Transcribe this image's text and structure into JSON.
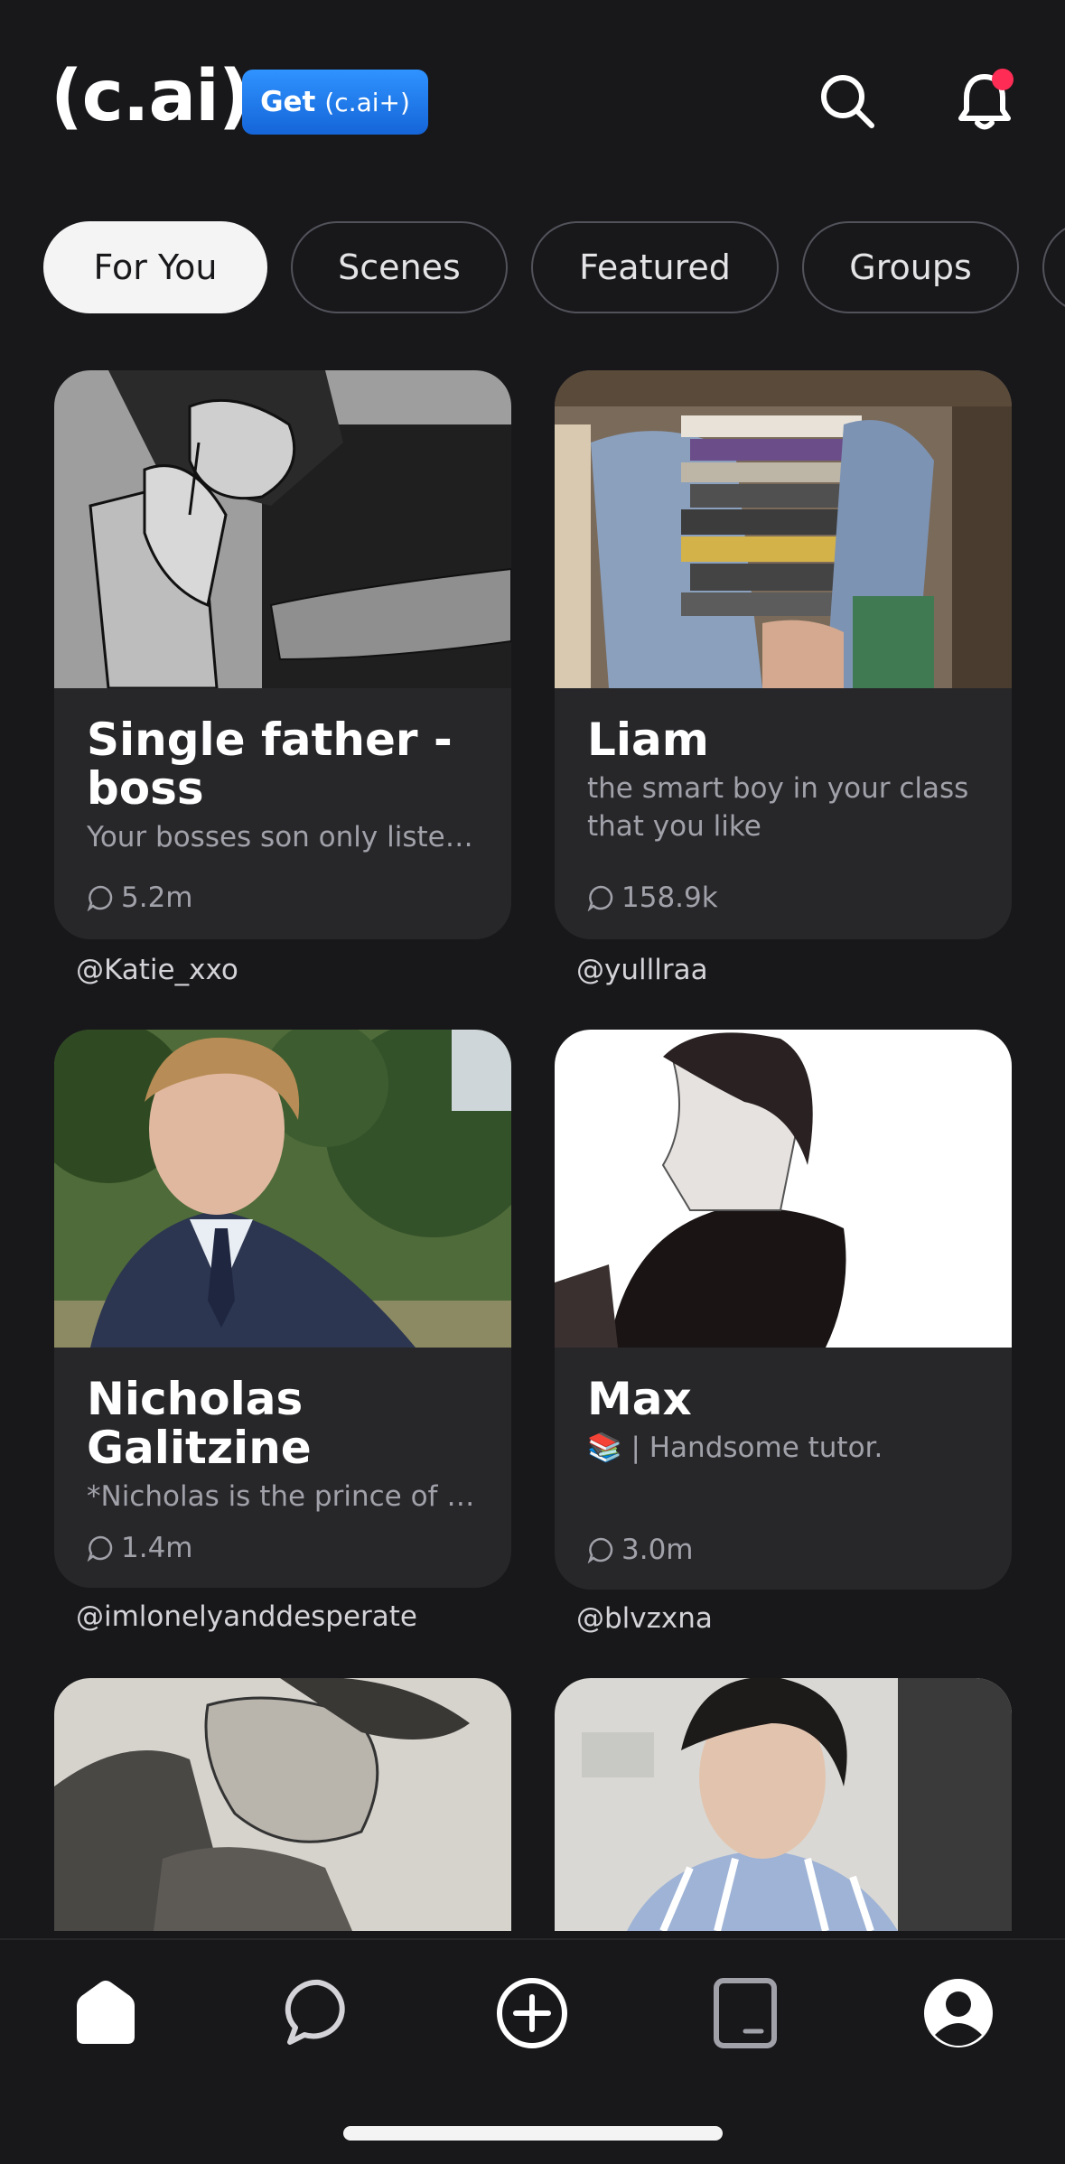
{
  "header": {
    "logo": "(c.ai)",
    "plus_get": "Get",
    "plus_tier": "(c.ai+)",
    "search_icon": "search-icon",
    "bell_icon": "bell-icon",
    "colors": {
      "accent": "#1f7ae8",
      "notify_dot": "#ff2d55"
    }
  },
  "tabs": [
    {
      "label": "For You",
      "active": true
    },
    {
      "label": "Scenes"
    },
    {
      "label": "Featured"
    },
    {
      "label": "Groups"
    }
  ],
  "cards": [
    {
      "title": "Single father - boss",
      "description": "Your bosses son only listen...",
      "chats": "5.2m",
      "creator": "@Katie_xxo"
    },
    {
      "title": "Liam",
      "description": "the smart boy in your class that you like",
      "chats": "158.9k",
      "creator": "@yulllraa"
    },
    {
      "title": "Nicholas Galitzine",
      "description": "*Nicholas is the prince of t...",
      "chats": "1.4m",
      "creator": "@imlonelyanddesperate"
    },
    {
      "title": "Max",
      "description": "📚 | Handsome tutor.",
      "chats": "3.0m",
      "creator": "@blvzxna"
    }
  ],
  "bottom_nav": [
    {
      "icon": "home-icon",
      "active": true
    },
    {
      "icon": "chat-icon"
    },
    {
      "icon": "create-icon"
    },
    {
      "icon": "feed-icon"
    },
    {
      "icon": "profile-icon"
    }
  ]
}
